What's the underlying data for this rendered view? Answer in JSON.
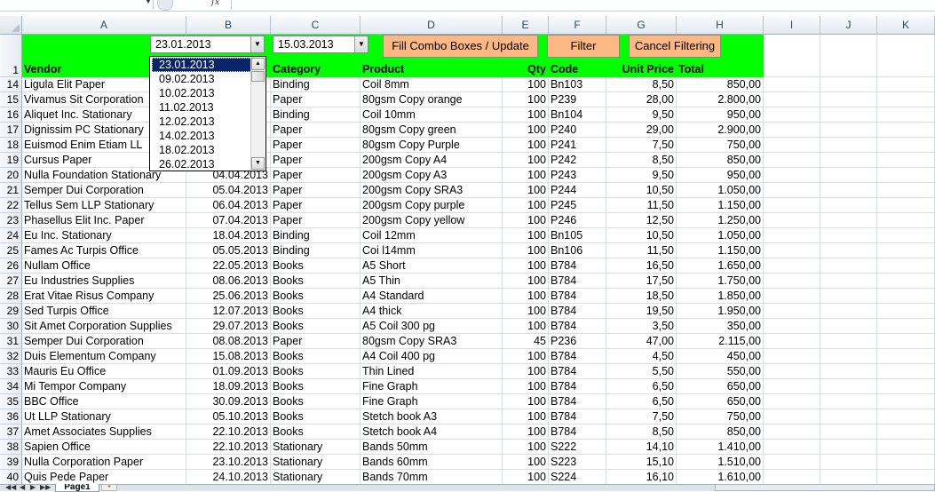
{
  "formula_bar": {
    "name_box": "",
    "fx_label": "fx",
    "content": ""
  },
  "columns": [
    "A",
    "B",
    "C",
    "D",
    "E",
    "F",
    "G",
    "H",
    "I",
    "J",
    "K"
  ],
  "controls": {
    "combo_from": "23.01.2013",
    "combo_to": "15.03.2013",
    "fill_button": "Fill Combo Boxes / Update",
    "filter_button": "Filter",
    "cancel_button": "Cancel Filtering"
  },
  "dropdown": {
    "items": [
      "23.01.2013",
      "09.02.2013",
      "10.02.2013",
      "11.02.2013",
      "12.02.2013",
      "14.02.2013",
      "18.02.2013",
      "26.02.2013"
    ],
    "selected_index": 0,
    "scroll_up": "▲",
    "scroll_down": "▼"
  },
  "headers": {
    "row_number": "1",
    "vendor": "Vendor",
    "date": "",
    "category": "Category",
    "product": "Product",
    "qty": "Qty",
    "code": "Code",
    "unit_price": "Unit Price",
    "total": "Total"
  },
  "rows": [
    {
      "n": "14",
      "vendor": "Ligula Elit Paper",
      "date": "",
      "category": "Binding",
      "product": "Coil 8mm",
      "qty": "100",
      "code": "Bn103",
      "price": "8,50",
      "total": "850,00"
    },
    {
      "n": "15",
      "vendor": "Vivamus Sit Corporation",
      "date": "",
      "category": "Paper",
      "product": "80gsm Copy orange",
      "qty": "100",
      "code": "P239",
      "price": "28,00",
      "total": "2.800,00"
    },
    {
      "n": "16",
      "vendor": "Aliquet Inc. Stationary",
      "date": "",
      "category": "Binding",
      "product": "Coil 10mm",
      "qty": "100",
      "code": "Bn104",
      "price": "9,50",
      "total": "950,00"
    },
    {
      "n": "17",
      "vendor": "Dignissim PC Stationary",
      "date": "",
      "category": "Paper",
      "product": "80gsm Copy green",
      "qty": "100",
      "code": "P240",
      "price": "29,00",
      "total": "2.900,00"
    },
    {
      "n": "18",
      "vendor": "Euismod Enim Etiam LL",
      "date": "",
      "category": "Paper",
      "product": "80gsm Copy Purple",
      "qty": "100",
      "code": "P241",
      "price": "7,50",
      "total": "750,00"
    },
    {
      "n": "19",
      "vendor": "Cursus  Paper",
      "date": "",
      "category": "Paper",
      "product": "200gsm Copy A4",
      "qty": "100",
      "code": "P242",
      "price": "8,50",
      "total": "850,00"
    },
    {
      "n": "20",
      "vendor": "Nulla Foundation Stationary",
      "date": "04.04.2013",
      "category": "Paper",
      "product": "200gsm Copy A3",
      "qty": "100",
      "code": "P243",
      "price": "9,50",
      "total": "950,00"
    },
    {
      "n": "21",
      "vendor": "Semper Dui Corporation",
      "date": "05.04.2013",
      "category": "Paper",
      "product": "200gsm Copy SRA3",
      "qty": "100",
      "code": "P244",
      "price": "10,50",
      "total": "1.050,00"
    },
    {
      "n": "22",
      "vendor": "Tellus Sem LLP Stationary",
      "date": "06.04.2013",
      "category": "Paper",
      "product": "200gsm Copy purple",
      "qty": "100",
      "code": "P245",
      "price": "11,50",
      "total": "1.150,00"
    },
    {
      "n": "23",
      "vendor": "Phasellus Elit Inc. Paper",
      "date": "07.04.2013",
      "category": "Paper",
      "product": "200gsm Copy yellow",
      "qty": "100",
      "code": "P246",
      "price": "12,50",
      "total": "1.250,00"
    },
    {
      "n": "24",
      "vendor": "Eu Inc. Stationary",
      "date": "18.04.2013",
      "category": "Binding",
      "product": "Coil 12mm",
      "qty": "100",
      "code": "Bn105",
      "price": "10,50",
      "total": "1.050,00"
    },
    {
      "n": "25",
      "vendor": "Fames Ac Turpis  Office",
      "date": "05.05.2013",
      "category": "Binding",
      "product": "Coi l14mm",
      "qty": "100",
      "code": "Bn106",
      "price": "11,50",
      "total": "1.150,00"
    },
    {
      "n": "26",
      "vendor": "Nullam  Office",
      "date": "22.05.2013",
      "category": "Books",
      "product": "A5 Short",
      "qty": "100",
      "code": "B784",
      "price": "16,50",
      "total": "1.650,00"
    },
    {
      "n": "27",
      "vendor": "Eu Industries Supplies",
      "date": "08.06.2013",
      "category": "Books",
      "product": "A5 Thin",
      "qty": "100",
      "code": "B784",
      "price": "17,50",
      "total": "1.750,00"
    },
    {
      "n": "28",
      "vendor": "Erat Vitae Risus Company",
      "date": "25.06.2013",
      "category": "Books",
      "product": "A4 Standard",
      "qty": "100",
      "code": "B784",
      "price": "18,50",
      "total": "1.850,00"
    },
    {
      "n": "29",
      "vendor": "Sed Turpis Office",
      "date": "12.07.2013",
      "category": "Books",
      "product": "A4 thick",
      "qty": "100",
      "code": "B784",
      "price": "19,50",
      "total": "1.950,00"
    },
    {
      "n": "30",
      "vendor": "Sit Amet Corporation Supplies",
      "date": "29.07.2013",
      "category": "Books",
      "product": "A5 Coil 300 pg",
      "qty": "100",
      "code": "B784",
      "price": "3,50",
      "total": "350,00"
    },
    {
      "n": "31",
      "vendor": "Semper Dui Corporation",
      "date": "08.08.2013",
      "category": "Paper",
      "product": "80gsm Copy SRA3",
      "qty": "45",
      "code": "P236",
      "price": "47,00",
      "total": "2.115,00"
    },
    {
      "n": "32",
      "vendor": "Duis Elementum Company",
      "date": "15.08.2013",
      "category": "Books",
      "product": "A4 Coil 400 pg",
      "qty": "100",
      "code": "B784",
      "price": "4,50",
      "total": "450,00"
    },
    {
      "n": "33",
      "vendor": "Mauris Eu Office",
      "date": "01.09.2013",
      "category": "Books",
      "product": "Thin Lined",
      "qty": "100",
      "code": "B784",
      "price": "5,50",
      "total": "550,00"
    },
    {
      "n": "34",
      "vendor": "Mi Tempor Company",
      "date": "18.09.2013",
      "category": "Books",
      "product": "Fine Graph",
      "qty": "100",
      "code": "B784",
      "price": "6,50",
      "total": "650,00"
    },
    {
      "n": "35",
      "vendor": "BBC Office",
      "date": "30.09.2013",
      "category": "Books",
      "product": "Fine Graph",
      "qty": "100",
      "code": "B784",
      "price": "6,50",
      "total": "650,00"
    },
    {
      "n": "36",
      "vendor": "Ut LLP Stationary",
      "date": "05.10.2013",
      "category": "Books",
      "product": "Stetch book A3",
      "qty": "100",
      "code": "B784",
      "price": "7,50",
      "total": "750,00"
    },
    {
      "n": "37",
      "vendor": "Amet Associates Supplies",
      "date": "22.10.2013",
      "category": "Books",
      "product": "Stetch book A4",
      "qty": "100",
      "code": "B784",
      "price": "8,50",
      "total": "850,00"
    },
    {
      "n": "38",
      "vendor": "Sapien  Office",
      "date": "22.10.2013",
      "category": "Stationary",
      "product": "Bands 50mm",
      "qty": "100",
      "code": "S222",
      "price": "14,10",
      "total": "1.410,00"
    },
    {
      "n": "39",
      "vendor": "Nulla Corporation Paper",
      "date": "23.10.2013",
      "category": "Stationary",
      "product": "Bands 60mm",
      "qty": "100",
      "code": "S223",
      "price": "15,10",
      "total": "1.510,00"
    },
    {
      "n": "40",
      "vendor": "Quis Pede  Paper",
      "date": "24.10.2013",
      "category": "Stationary",
      "product": "Bands 70mm",
      "qty": "100",
      "code": "S224",
      "price": "16,10",
      "total": "1.610,00"
    }
  ],
  "sheet_tabs": {
    "active": "Page1",
    "nav": [
      "◀◀",
      "◀",
      "▶",
      "▶▶"
    ]
  },
  "colors": {
    "header_fill": "#00ff00",
    "button_fill": "#fbb882",
    "dropdown_selection": "#0a246a"
  }
}
